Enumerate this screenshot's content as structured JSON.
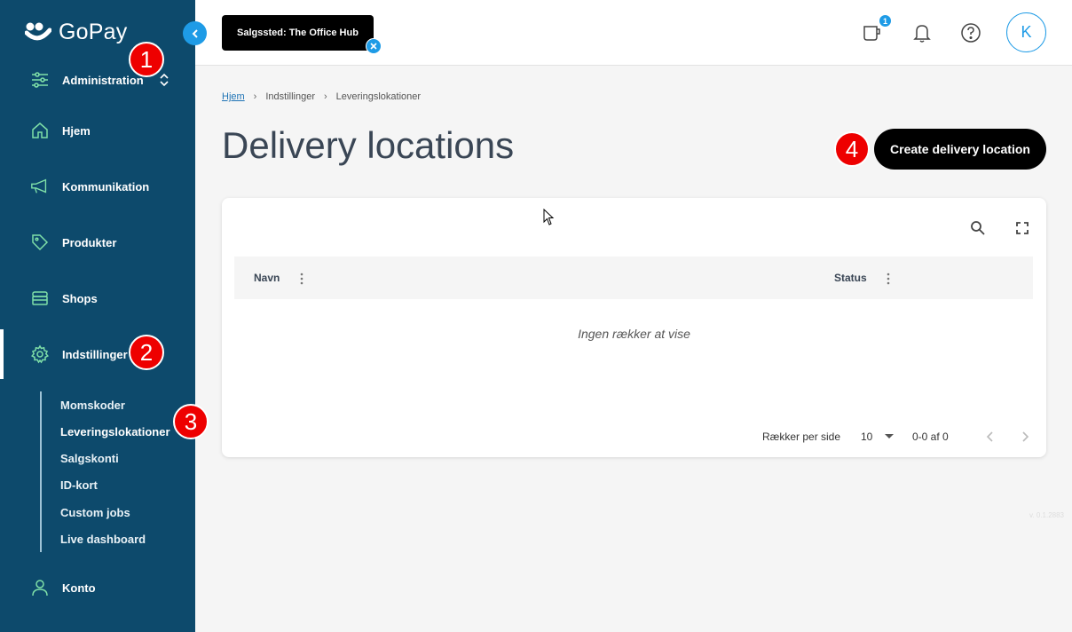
{
  "app": {
    "name": "GoPay"
  },
  "sidebar": {
    "admin_label": "Administration",
    "items": [
      {
        "label": "Hjem",
        "icon": "home-icon"
      },
      {
        "label": "Kommunikation",
        "icon": "megaphone-icon"
      },
      {
        "label": "Produkter",
        "icon": "tag-icon"
      },
      {
        "label": "Shops",
        "icon": "store-icon"
      },
      {
        "label": "Indstillinger",
        "icon": "gear-icon"
      },
      {
        "label": "Konto",
        "icon": "person-icon"
      }
    ],
    "sub_items": [
      "Momskoder",
      "Leveringslokationer",
      "Salgskonti",
      "ID-kort",
      "Custom jobs",
      "Live dashboard"
    ],
    "active_sub": "Leveringslokationer"
  },
  "topbar": {
    "shop_chip": "Salgssted: The Office Hub",
    "notification_count": "1",
    "avatar_initial": "K"
  },
  "breadcrumb": [
    "Hjem",
    "Indstillinger",
    "Leveringslokationer"
  ],
  "page": {
    "title": "Delivery locations",
    "create_button": "Create delivery location"
  },
  "table": {
    "columns": [
      "Navn",
      "Status"
    ],
    "empty_message": "Ingen rækker at vise",
    "rows_per_page_label": "Rækker per side",
    "rows_per_page": "10",
    "range": "0-0 af 0"
  },
  "version": "v. 0.1.2883",
  "markers": [
    "1",
    "2",
    "3",
    "4"
  ],
  "colors": {
    "sidebar": "#0d4a6c",
    "accent": "#1e9be6",
    "icon_green": "#7fe0a8",
    "marker": "#e00000"
  }
}
